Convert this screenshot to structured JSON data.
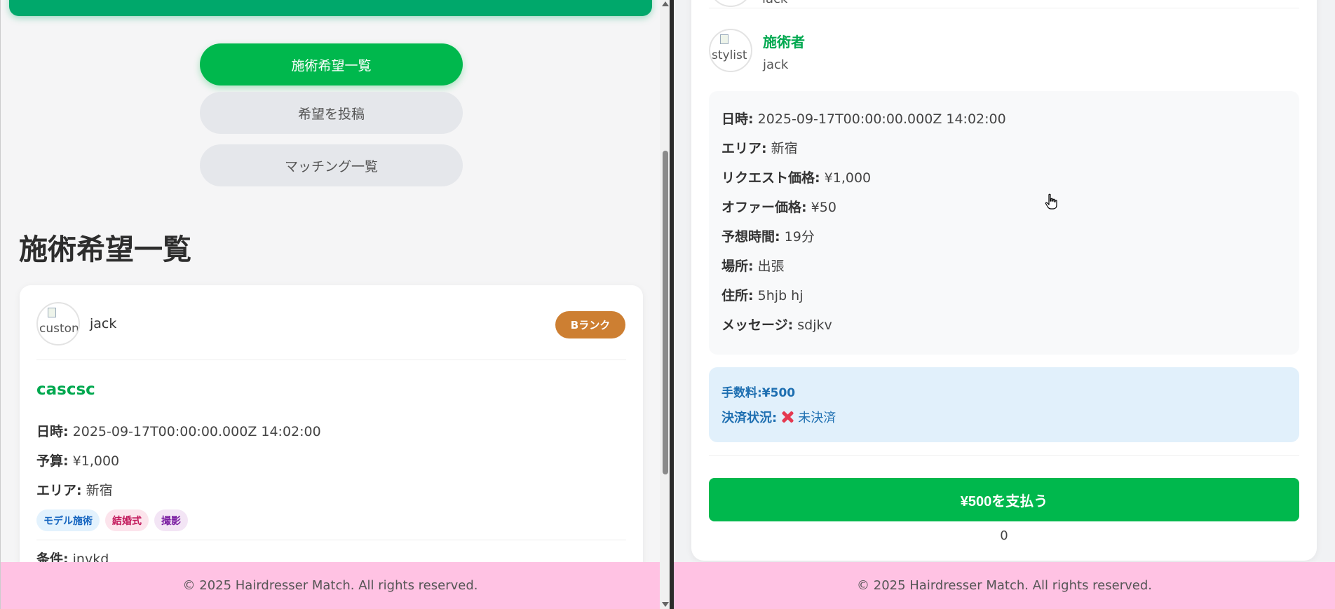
{
  "left": {
    "nav": {
      "list_label": "施術希望一覧",
      "post_label": "希望を投稿",
      "matching_label": "マッチング一覧"
    },
    "page_title": "施術希望一覧",
    "card": {
      "avatar_alt": "custon",
      "customer_name": "jack",
      "rank_badge": "Bランク",
      "title": "cascsc",
      "rows": [
        {
          "label": "日時:",
          "value": "2025-09-17T00:00:00.000Z 14:02:00"
        },
        {
          "label": "予算:",
          "value": "¥1,000"
        },
        {
          "label": "エリア:",
          "value": "新宿"
        }
      ],
      "tags": [
        "モデル施術",
        "結婚式",
        "撮影"
      ],
      "condition": {
        "label": "条件:",
        "value": "invkd"
      }
    },
    "footer": "© 2025 Hairdresser Match. All rights reserved."
  },
  "right": {
    "previous_name": "jack",
    "stylist": {
      "avatar_alt": "stylist",
      "label": "施術者",
      "name": "jack"
    },
    "details": [
      {
        "label": "日時:",
        "value": "2025-09-17T00:00:00.000Z 14:02:00"
      },
      {
        "label": "エリア:",
        "value": "新宿"
      },
      {
        "label": "リクエスト価格:",
        "value": "¥1,000"
      },
      {
        "label": "オファー価格:",
        "value": "¥50"
      },
      {
        "label": "予想時間:",
        "value": "19分"
      },
      {
        "label": "場所:",
        "value": "出張"
      },
      {
        "label": "住所:",
        "value": "5hjb hj"
      },
      {
        "label": "メッセージ:",
        "value": "sdjkv"
      }
    ],
    "fee": "手数料:¥500",
    "payment_status_label": "決済状況:",
    "payment_status_value": "未決済",
    "pay_button": "¥500を支払う",
    "counter": "0",
    "footer": "© 2025 Hairdresser Match. All rights reserved."
  },
  "colors": {
    "primary_green": "#00b84d",
    "title_green": "#00a84f",
    "rank_bronze": "#cd7f32",
    "footer_pink": "#ffc2e3",
    "fee_blue_bg": "#e1f0fb",
    "status_red": "#e53950"
  },
  "icons": {
    "payment_status": "cross-mark-icon",
    "cursor": "hand-pointer-cursor"
  }
}
